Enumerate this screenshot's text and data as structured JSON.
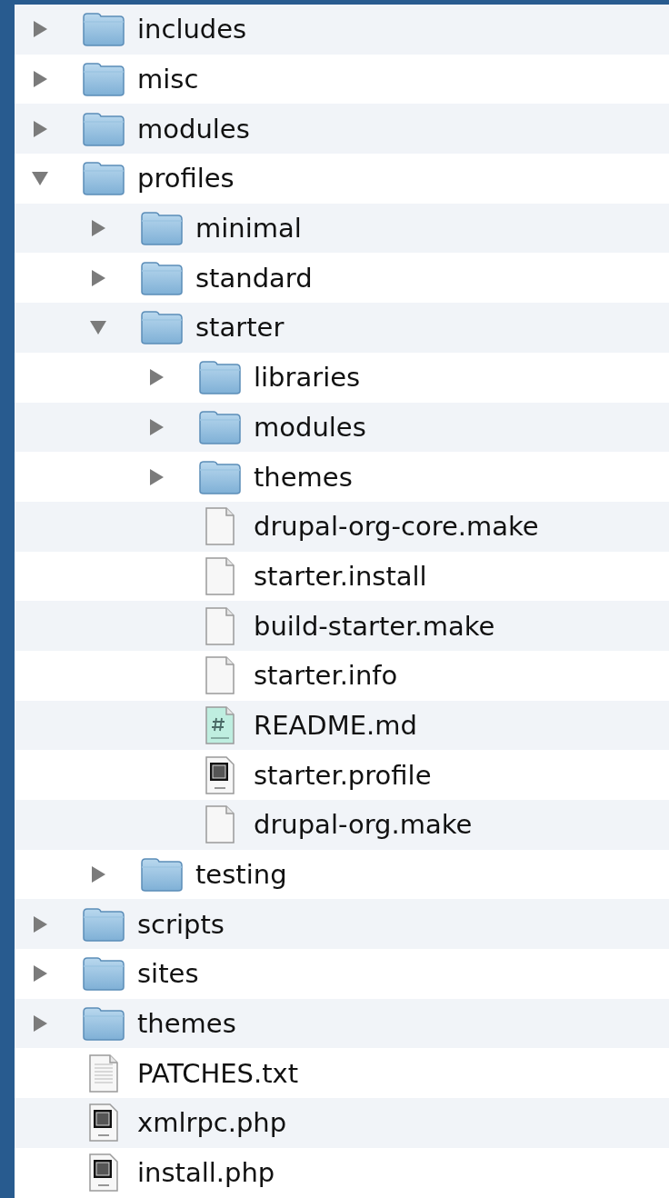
{
  "items": [
    {
      "name": "includes",
      "kind": "folder",
      "expanded": false
    },
    {
      "name": "misc",
      "kind": "folder",
      "expanded": false
    },
    {
      "name": "modules",
      "kind": "folder",
      "expanded": false
    },
    {
      "name": "profiles",
      "kind": "folder",
      "expanded": true,
      "children": [
        {
          "name": "minimal",
          "kind": "folder",
          "expanded": false
        },
        {
          "name": "standard",
          "kind": "folder",
          "expanded": false
        },
        {
          "name": "starter",
          "kind": "folder",
          "expanded": true,
          "children": [
            {
              "name": "libraries",
              "kind": "folder",
              "expanded": false
            },
            {
              "name": "modules",
              "kind": "folder",
              "expanded": false
            },
            {
              "name": "themes",
              "kind": "folder",
              "expanded": false
            },
            {
              "name": "drupal-org-core.make",
              "kind": "file"
            },
            {
              "name": "starter.install",
              "kind": "file"
            },
            {
              "name": "build-starter.make",
              "kind": "file"
            },
            {
              "name": "starter.info",
              "kind": "file"
            },
            {
              "name": "README.md",
              "kind": "markdown"
            },
            {
              "name": "starter.profile",
              "kind": "shell"
            },
            {
              "name": "drupal-org.make",
              "kind": "file"
            }
          ]
        },
        {
          "name": "testing",
          "kind": "folder",
          "expanded": false
        }
      ]
    },
    {
      "name": "scripts",
      "kind": "folder",
      "expanded": false
    },
    {
      "name": "sites",
      "kind": "folder",
      "expanded": false
    },
    {
      "name": "themes",
      "kind": "folder",
      "expanded": false
    },
    {
      "name": "PATCHES.txt",
      "kind": "text"
    },
    {
      "name": "xmlrpc.php",
      "kind": "php"
    },
    {
      "name": "install.php",
      "kind": "php"
    }
  ]
}
